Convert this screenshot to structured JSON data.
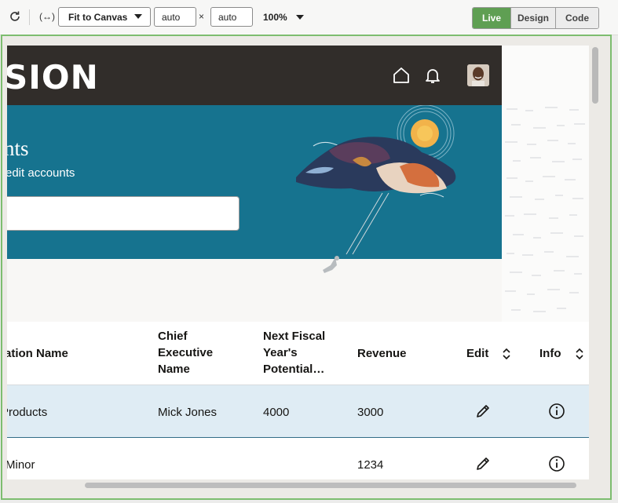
{
  "toolbar": {
    "refresh_icon": "refresh-icon",
    "fit_icon": "fit-width-icon",
    "fit_label": "(↔)",
    "fit_select": "Fit to Canvas",
    "width_value": "auto",
    "height_value": "auto",
    "times": "×",
    "zoom": "100%",
    "modes": [
      "Live",
      "Design",
      "Code"
    ],
    "active_mode": "Live"
  },
  "app": {
    "brand": "SION",
    "hero_title": "nts",
    "hero_subtitle": "edit accounts",
    "search_value": ""
  },
  "table": {
    "headers": [
      "ation Name",
      "Chief Executive Name",
      "Next Fiscal Year's Potential…",
      "Revenue",
      "Edit",
      "Info"
    ],
    "rows": [
      {
        "name": "Products",
        "ceo": "Mick Jones",
        "potential": "4000",
        "revenue": "3000"
      },
      {
        "name": "Minor",
        "ceo": "",
        "potential": "",
        "revenue": "1234"
      }
    ]
  },
  "colors": {
    "header": "#312d2a",
    "hero": "#16738f",
    "live": "#5f9f53",
    "selected_row": "#dfecf4"
  }
}
